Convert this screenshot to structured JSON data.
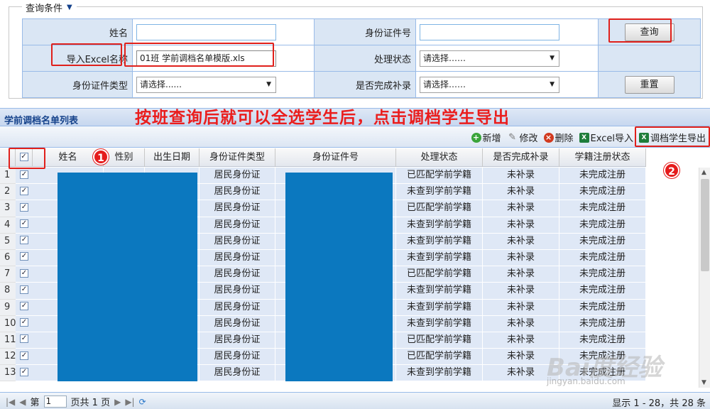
{
  "query": {
    "legend": "查询条件",
    "fields": {
      "name_label": "姓名",
      "name_value": "",
      "id_label": "身份证件号",
      "id_value": "",
      "excel_label": "导入Excel名称",
      "excel_value": "01班  学前调档名单模版.xls",
      "status_label": "处理状态",
      "status_value": "请选择……",
      "idtype_label": "身份证件类型",
      "idtype_value": "请选择......",
      "complete_label": "是否完成补录",
      "complete_value": "请选择……"
    },
    "search_button": "查询",
    "reset_button": "重置"
  },
  "panel": {
    "title": "学前调档名单列表",
    "annotation": "按班查询后就可以全选学生后，点击调档学生导出"
  },
  "toolbar": {
    "add": "新增",
    "edit": "修改",
    "delete": "删除",
    "import": "Excel导入",
    "export": "调档学生导出"
  },
  "columns": [
    "姓名",
    "性别",
    "出生日期",
    "身份证件类型",
    "身份证件号",
    "处理状态",
    "是否完成补录",
    "学籍注册状态"
  ],
  "rows": [
    {
      "n": "1",
      "idtype": "居民身份证",
      "status": "已匹配学前学籍",
      "complete": "未补录",
      "reg": "未完成注册"
    },
    {
      "n": "2",
      "idtype": "居民身份证",
      "status": "未查到学前学籍",
      "complete": "未补录",
      "reg": "未完成注册"
    },
    {
      "n": "3",
      "idtype": "居民身份证",
      "status": "已匹配学前学籍",
      "complete": "未补录",
      "reg": "未完成注册"
    },
    {
      "n": "4",
      "idtype": "居民身份证",
      "status": "未查到学前学籍",
      "complete": "未补录",
      "reg": "未完成注册"
    },
    {
      "n": "5",
      "idtype": "居民身份证",
      "status": "未查到学前学籍",
      "complete": "未补录",
      "reg": "未完成注册"
    },
    {
      "n": "6",
      "idtype": "居民身份证",
      "status": "未查到学前学籍",
      "complete": "未补录",
      "reg": "未完成注册"
    },
    {
      "n": "7",
      "idtype": "居民身份证",
      "status": "已匹配学前学籍",
      "complete": "未补录",
      "reg": "未完成注册"
    },
    {
      "n": "8",
      "idtype": "居民身份证",
      "status": "未查到学前学籍",
      "complete": "未补录",
      "reg": "未完成注册"
    },
    {
      "n": "9",
      "idtype": "居民身份证",
      "status": "未查到学前学籍",
      "complete": "未补录",
      "reg": "未完成注册"
    },
    {
      "n": "10",
      "idtype": "居民身份证",
      "status": "未查到学前学籍",
      "complete": "未补录",
      "reg": "未完成注册"
    },
    {
      "n": "11",
      "idtype": "居民身份证",
      "status": "已匹配学前学籍",
      "complete": "未补录",
      "reg": "未完成注册"
    },
    {
      "n": "12",
      "idtype": "居民身份证",
      "status": "已匹配学前学籍",
      "complete": "未补录",
      "reg": "未完成注册"
    },
    {
      "n": "13",
      "idtype": "居民身份证",
      "status": "未查到学前学籍",
      "complete": "未补录",
      "reg": "未完成注册"
    }
  ],
  "pager": {
    "page_prefix": "第",
    "page_value": "1",
    "page_suffix": "页共 1 页",
    "summary": "显示 1 - 28，共 28 条"
  },
  "markers": {
    "one": "1",
    "two": "2"
  },
  "watermark": {
    "text": "Bai度经验",
    "url": "jingyan.baidu.com"
  }
}
